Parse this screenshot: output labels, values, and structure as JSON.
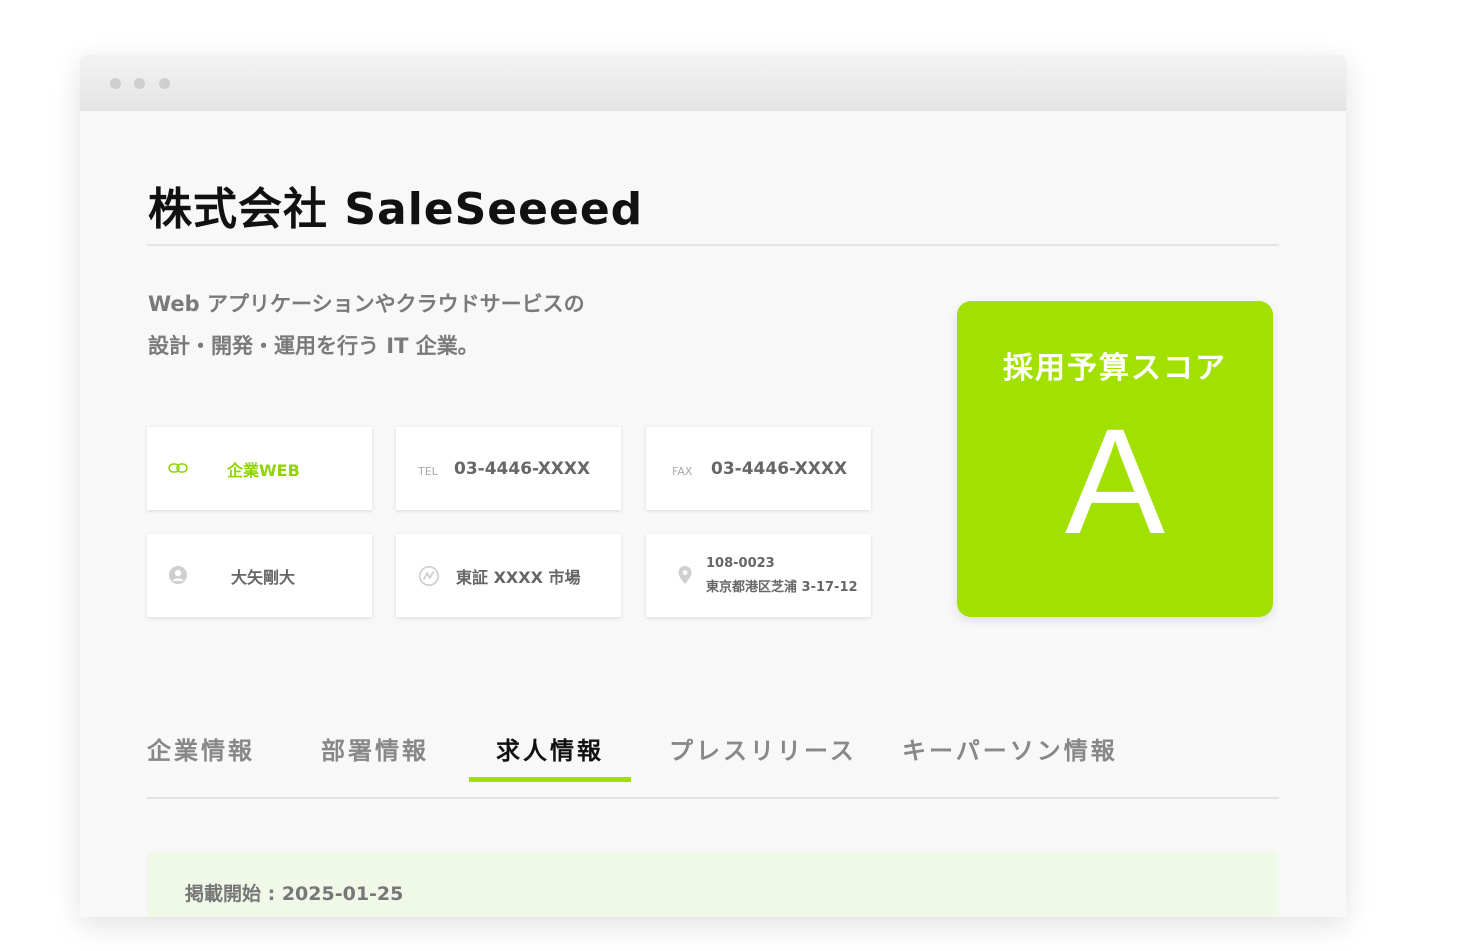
{
  "company": {
    "name": "株式会社 SaleSeeeed",
    "description_line1": "Web アプリケーションやクラウドサービスの",
    "description_line2": "設計・開発・運用を行う IT 企業。"
  },
  "info_cards": {
    "website": {
      "icon": "link-icon",
      "label": "企業WEB"
    },
    "tel": {
      "prefix": "TEL",
      "value": "03-4446-XXXX"
    },
    "fax": {
      "prefix": "FAX",
      "value": "03-4446-XXXX"
    },
    "ceo": {
      "icon": "person-icon",
      "value": "大矢剛大"
    },
    "market": {
      "icon": "stock-chart-icon",
      "value": "東証 XXXX 市場"
    },
    "address": {
      "icon": "location-pin-icon",
      "postal": "108-0023",
      "street": "東京都港区芝浦 3-17-12"
    }
  },
  "score": {
    "title": "採用予算スコア",
    "grade": "A",
    "color": "#a2e000"
  },
  "tabs": [
    {
      "label": "企業情報",
      "active": false
    },
    {
      "label": "部署情報",
      "active": false
    },
    {
      "label": "求人情報",
      "active": true
    },
    {
      "label": "プレスリリース",
      "active": false
    },
    {
      "label": "キーパーソン情報",
      "active": false
    }
  ],
  "job": {
    "posting_date": "掲載開始 : 2025-01-25"
  },
  "colors": {
    "accent": "#a2e000",
    "link_text": "#8fd400"
  }
}
